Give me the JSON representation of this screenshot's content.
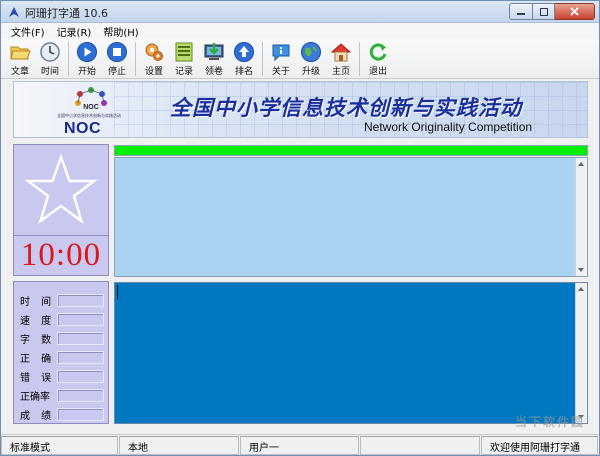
{
  "window": {
    "title": "阿珊打字通 10.6"
  },
  "menu": [
    {
      "label": "文件(F)"
    },
    {
      "label": "记录(R)"
    },
    {
      "label": "帮助(H)"
    }
  ],
  "toolbar": {
    "doc": "文章",
    "time": "时间",
    "start": "开始",
    "stop": "停止",
    "settings": "设置",
    "record": "记录",
    "exam": "领卷",
    "rank": "排名",
    "about": "关于",
    "upgrade": "升级",
    "home": "主页",
    "exit": "退出"
  },
  "banner": {
    "title_cn": "全国中小学信息技术创新与实践活动",
    "title_en": "Network Originality Competition",
    "logo_text": "NOC",
    "logo_small": "全国中小学信息技术创新与实践活动"
  },
  "timer": {
    "value": "10:00"
  },
  "stats": {
    "time": "时 间",
    "speed": "速 度",
    "chars": "字 数",
    "correct": "正 确",
    "errors": "错 误",
    "accuracy": "正确率",
    "score": "成 绩"
  },
  "progress": {
    "fraction": 1.0,
    "color": "#00ee00"
  },
  "status": {
    "mode": "标准模式",
    "location": "本地",
    "user": "用户一",
    "empty": "",
    "welcome": "欢迎使用阿珊打字通"
  },
  "watermark": "当下软件园",
  "colors": {
    "left_panel": "#c9c8ee",
    "timer": "#e0161a",
    "top_pane": "#a8d4f2",
    "bottom_pane": "#0078c1"
  }
}
